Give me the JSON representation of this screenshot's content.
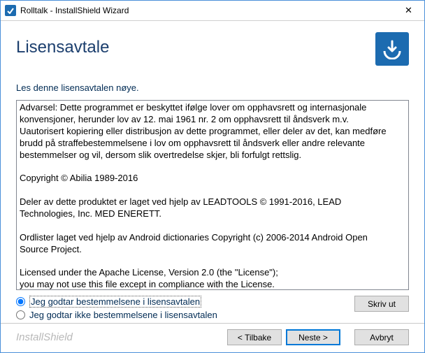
{
  "window": {
    "title": "Rolltalk - InstallShield Wizard"
  },
  "header": {
    "heading": "Lisensavtale"
  },
  "instruction": "Les denne lisensavtalen nøye.",
  "license_text": "Advarsel: Dette programmet er beskyttet ifølge lover om opphavsrett og internasjonale konvensjoner, herunder lov av 12. mai 1961 nr. 2 om opphavsrett til åndsverk m.v. Uautorisert kopiering eller distribusjon av dette programmet, eller deler av det, kan medføre brudd på straffebestemmelsene i lov om opphavsrett til åndsverk eller andre relevante bestemmelser og vil, dersom slik overtredelse skjer, bli forfulgt rettslig.\n\nCopyright © Abilia 1989-2016\n\nDeler av dette produktet er laget ved hjelp av LEADTOOLS © 1991-2016, LEAD Technologies, Inc. MED ENERETT.\n\nOrdlister laget ved hjelp av Android dictionaries Copyright (c) 2006-2014 Android Open Source Project.\n\nLicensed under the Apache License, Version 2.0 (the \"License\");\nyou may not use this file except in compliance with the License.\nYou may obtain a copy of the License at",
  "radios": {
    "accept": "Jeg godtar bestemmelsene i lisensavtalen",
    "decline": "Jeg godtar ikke bestemmelsene i lisensavtalen"
  },
  "buttons": {
    "print": "Skriv ut",
    "back": "< Tilbake",
    "next": "Neste >",
    "cancel": "Avbryt"
  },
  "footer": {
    "brand": "InstallShield"
  }
}
